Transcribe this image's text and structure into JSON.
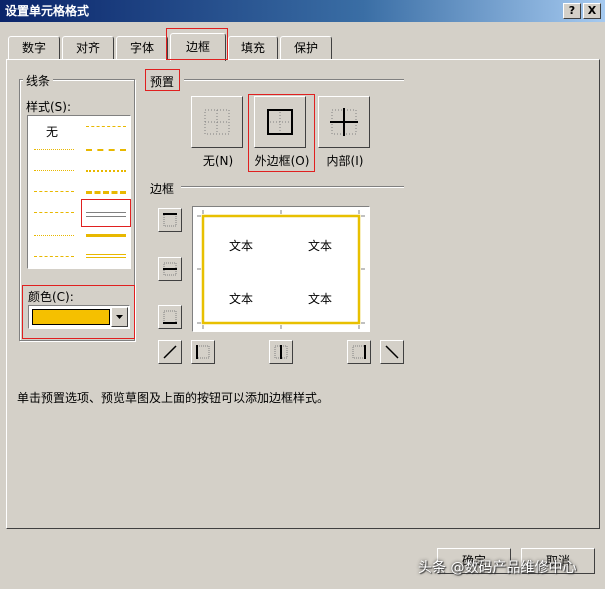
{
  "window": {
    "title": "设置单元格格式",
    "help_label": "?",
    "close_label": "X"
  },
  "tabs": [
    {
      "label": "数字"
    },
    {
      "label": "对齐"
    },
    {
      "label": "字体"
    },
    {
      "label": "边框",
      "active": true
    },
    {
      "label": "填充"
    },
    {
      "label": "保护"
    }
  ],
  "line": {
    "group_title": "线条",
    "style_label": "样式(S):",
    "none_label": "无",
    "color_label": "颜色(C):",
    "selected_color": "#f5c000",
    "line_color": "#e8b800"
  },
  "presets": {
    "title": "预置",
    "items": [
      {
        "label": "无(N)"
      },
      {
        "label": "外边框(O)"
      },
      {
        "label": "内部(I)"
      }
    ]
  },
  "border": {
    "title": "边框",
    "preview_text": [
      "文本",
      "文本",
      "文本",
      "文本"
    ],
    "border_color": "#e8c000"
  },
  "hint": "单击预置选项、预览草图及上面的按钮可以添加边框样式。",
  "buttons": {
    "ok": "确定",
    "cancel": "取消"
  },
  "watermark": "头条 @数码产品维修中心"
}
